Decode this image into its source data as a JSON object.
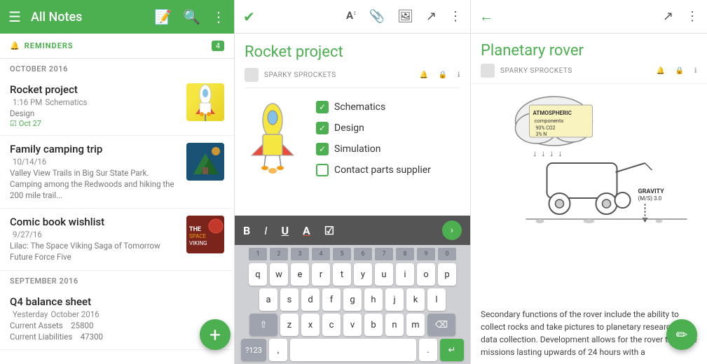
{
  "app": {
    "title": "All Notes"
  },
  "left": {
    "header": {
      "title": "All Notes",
      "menu_icon": "☰",
      "compose_icon": "⎘",
      "search_icon": "🔍",
      "more_icon": "⋮"
    },
    "reminders": {
      "label": "REMINDERS",
      "badge": "4"
    },
    "sections": [
      {
        "label": "OCTOBER 2016",
        "notes": [
          {
            "title": "Rocket project",
            "meta_date": "1:16 PM",
            "meta_extra": "Schematics",
            "reminder": "Oct 27",
            "thumb_type": "rocket"
          },
          {
            "title": "Family camping trip",
            "meta_date": "10/14/16",
            "meta_extra": "Valley View Trails in Big Sur State Park. Camping among the Redwoods and hiking the 200 mile trail...",
            "thumb_type": "camping"
          },
          {
            "title": "Comic book wishlist",
            "meta_date": "9/27/16",
            "meta_extra": "Lilac: The Space Viking Saga of Tomorrow Future Force Five",
            "thumb_type": "comic"
          }
        ]
      },
      {
        "label": "SEPTEMBER 2016",
        "notes": [
          {
            "title": "Q4 balance sheet",
            "meta_date": "Yesterday",
            "meta_extra": "October 2016",
            "line1_label": "Current Assets",
            "line1_value": "25800",
            "line2_label": "Current Liabilities",
            "line2_value": "47300",
            "thumb_type": "none"
          }
        ]
      }
    ],
    "fab_label": "+"
  },
  "mid": {
    "note_title": "Rocket project",
    "notebook": "SPARKY SPROCKETS",
    "checklist": [
      {
        "label": "Schematics",
        "checked": true
      },
      {
        "label": "Design",
        "checked": true
      },
      {
        "label": "Simulation",
        "checked": true
      },
      {
        "label": "Contact parts supplier",
        "checked": false
      }
    ],
    "format_bar": {
      "bold": "B",
      "italic": "I",
      "underline": "U",
      "font_color": "A",
      "checkbox": "☑"
    },
    "keyboard": {
      "row_numbers": [
        "1",
        "2",
        "3",
        "4",
        "5",
        "6",
        "7",
        "8",
        "9",
        "0"
      ],
      "row1": [
        "q",
        "w",
        "e",
        "r",
        "t",
        "y",
        "u",
        "i",
        "o",
        "p"
      ],
      "row2": [
        "a",
        "s",
        "d",
        "f",
        "g",
        "h",
        "j",
        "k",
        "l"
      ],
      "row3": [
        "z",
        "x",
        "c",
        "v",
        "b",
        "n",
        "m"
      ],
      "bottom": [
        "?123",
        ",",
        "space",
        ".",
        "↵"
      ]
    }
  },
  "right": {
    "note_title": "Planetary rover",
    "notebook": "SPARKY SPROCKETS",
    "description": "Secondary functions of the rover include the ability to collect rocks and take pictures to planetary research and data collection. Development allows for the rover to tackle missions lasting upwards of 24 hours with a",
    "drawing": {
      "cloud_label": "ATMOSPHERIC components",
      "cloud_sub": "90% CO2\n3% N",
      "gravity_label": "GRAVITY\n(M/S) 3.0",
      "arrows": [
        "↓",
        "↓",
        "↓",
        "↓"
      ]
    }
  }
}
